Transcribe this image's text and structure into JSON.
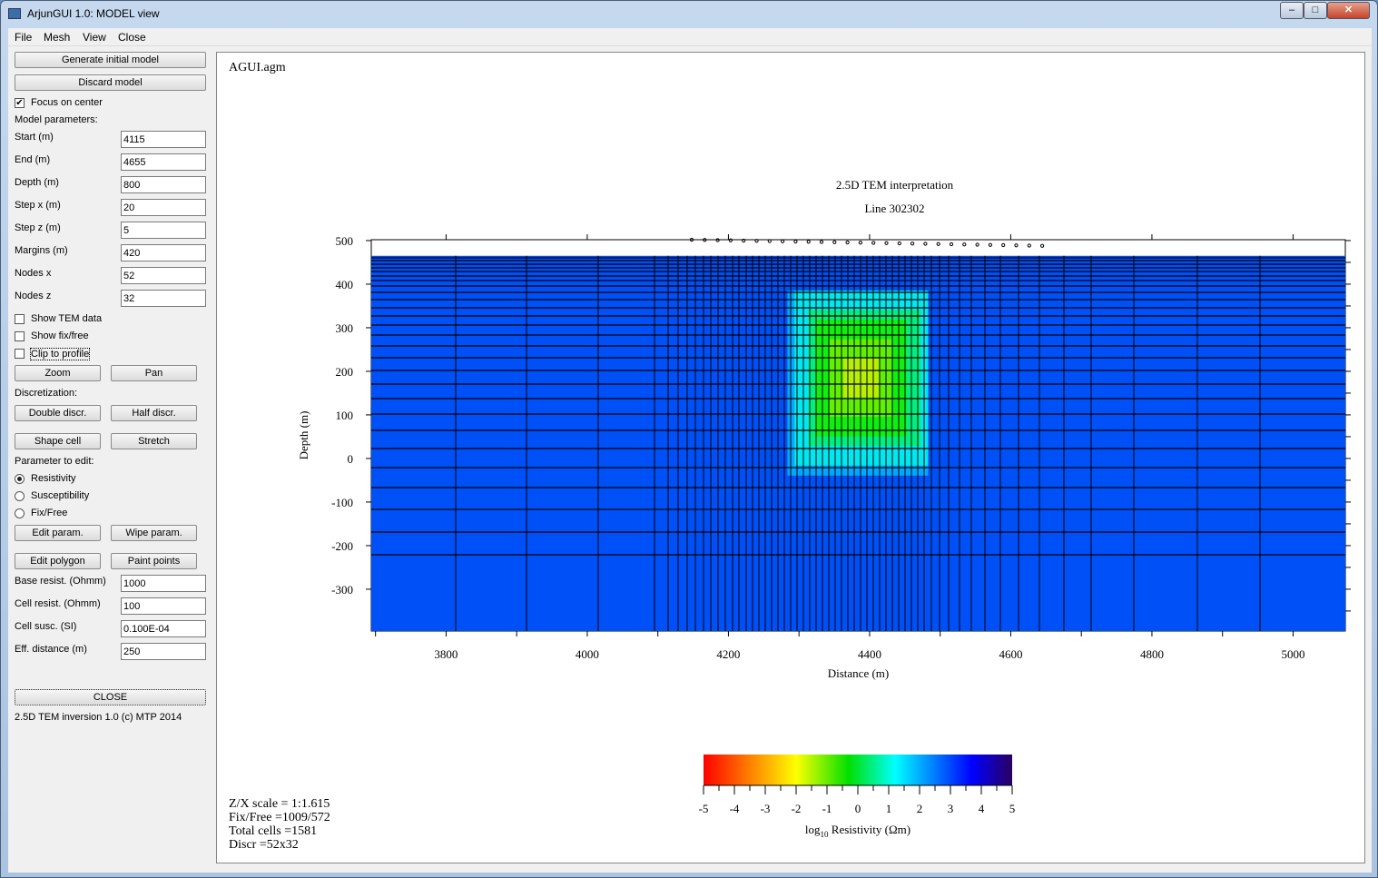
{
  "window": {
    "title": "ArjunGUI 1.0: MODEL view",
    "minimize": "‒",
    "maximize": "□",
    "close": "✕"
  },
  "menu": [
    "File",
    "Mesh",
    "View",
    "Close"
  ],
  "panel": {
    "generate": "Generate initial model",
    "discard": "Discard model",
    "focus_center": {
      "label": "Focus on center",
      "checked": true
    },
    "model_params_label": "Model parameters:",
    "params": [
      {
        "label": "Start (m)",
        "value": "4115"
      },
      {
        "label": "End (m)",
        "value": "4655"
      },
      {
        "label": "Depth (m)",
        "value": "800"
      },
      {
        "label": "Step x (m)",
        "value": "20"
      },
      {
        "label": "Step z (m)",
        "value": "5"
      },
      {
        "label": "Margins (m)",
        "value": "420"
      },
      {
        "label": "Nodes x",
        "value": "52"
      },
      {
        "label": "Nodes z",
        "value": "32"
      }
    ],
    "show_tem": {
      "label": "Show TEM data",
      "checked": false
    },
    "show_fix": {
      "label": "Show fix/free",
      "checked": false
    },
    "clip_profile": {
      "label": "Clip to profile",
      "checked": false
    },
    "zoom": "Zoom",
    "pan": "Pan",
    "discretization_label": "Discretization:",
    "double_discr": "Double discr.",
    "half_discr": "Half discr.",
    "shape_cell": "Shape cell",
    "stretch": "Stretch",
    "param_edit_label": "Parameter to edit:",
    "radios": [
      {
        "label": "Resistivity",
        "selected": true
      },
      {
        "label": "Susceptibility",
        "selected": false
      },
      {
        "label": "Fix/Free",
        "selected": false
      }
    ],
    "edit_param": "Edit param.",
    "wipe_param": "Wipe param.",
    "edit_polygon": "Edit polygon",
    "paint_points": "Paint points",
    "params2": [
      {
        "label": "Base resist. (Ohmm)",
        "value": "1000"
      },
      {
        "label": "Cell resist. (Ohmm)",
        "value": "100"
      },
      {
        "label": "Cell susc. (SI)",
        "value": "0.100E-04"
      },
      {
        "label": "Eff. distance (m)",
        "value": "250"
      }
    ],
    "close": "CLOSE",
    "footer": "2.5D TEM inversion 1.0 (c) MTP 2014"
  },
  "plot": {
    "file": "AGUI.agm",
    "title": "2.5D TEM interpretation",
    "subtitle": "Line   302302",
    "ylabel": "Depth  (m)",
    "xlabel": "Distance  (m)",
    "xticks": [
      3800,
      4000,
      4200,
      4400,
      4600,
      4800,
      5000
    ],
    "yticks": [
      500,
      400,
      300,
      200,
      100,
      0,
      -100,
      -200,
      -300
    ],
    "xlim": [
      3694,
      5074
    ],
    "ylim": [
      -396,
      502
    ],
    "colors": {
      "background": "#0050f8",
      "anomaly_core": "#a0f000"
    },
    "info": [
      "Z/X scale = 1:1.615",
      "Fix/Free =1009/572",
      "Total cells =1581",
      "Discr =52x32"
    ],
    "colorbar": {
      "ticks": [
        "-5",
        "-4",
        "-3",
        "-2",
        "-1",
        "0",
        "1",
        "2",
        "3",
        "4",
        "5"
      ],
      "label_pre": "log",
      "label_sub": "10",
      "label_post": " Resistivity (Ωm)"
    }
  }
}
